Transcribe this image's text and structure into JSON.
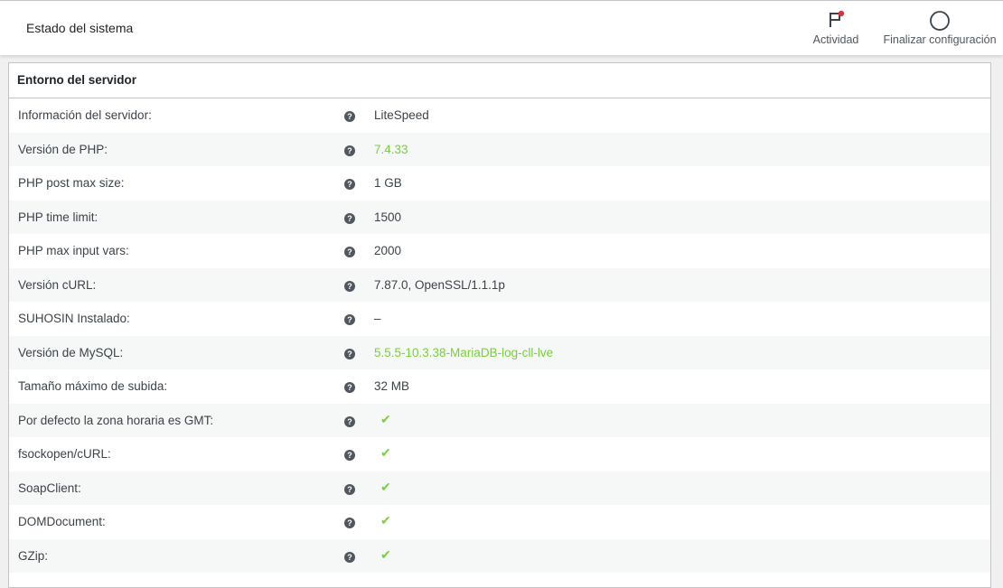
{
  "header": {
    "title": "Estado del sistema",
    "activity_label": "Actividad",
    "finish_label": "Finalizar configuración"
  },
  "panel": {
    "title": "Entorno del servidor"
  },
  "rows": [
    {
      "label": "Información del servidor:",
      "value": "LiteSpeed",
      "status": "plain"
    },
    {
      "label": "Versión de PHP:",
      "value": "7.4.33",
      "status": "good"
    },
    {
      "label": "PHP post max size:",
      "value": "1 GB",
      "status": "plain"
    },
    {
      "label": "PHP time limit:",
      "value": "1500",
      "status": "plain"
    },
    {
      "label": "PHP max input vars:",
      "value": "2000",
      "status": "plain"
    },
    {
      "label": "Versión cURL:",
      "value": "7.87.0, OpenSSL/1.1.1p",
      "status": "plain"
    },
    {
      "label": "SUHOSIN Instalado:",
      "value": "–",
      "status": "plain"
    },
    {
      "label": "Versión de MySQL:",
      "value": "5.5.5-10.3.38-MariaDB-log-cll-lve",
      "status": "good"
    },
    {
      "label": "Tamaño máximo de subida:",
      "value": "32 MB",
      "status": "plain"
    },
    {
      "label": "Por defecto la zona horaria es GMT:",
      "value": "✔",
      "status": "check"
    },
    {
      "label": "fsockopen/cURL:",
      "value": "✔",
      "status": "check"
    },
    {
      "label": "SoapClient:",
      "value": "✔",
      "status": "check"
    },
    {
      "label": "DOMDocument:",
      "value": "✔",
      "status": "check"
    },
    {
      "label": "GZip:",
      "value": "✔",
      "status": "check"
    }
  ],
  "help_glyph": "?",
  "colors": {
    "good": "#7ad03a",
    "notification_dot": "#d63638"
  },
  "icons": {
    "activity": "flag-icon",
    "finish": "circle-progress-icon",
    "help": "help-icon"
  }
}
